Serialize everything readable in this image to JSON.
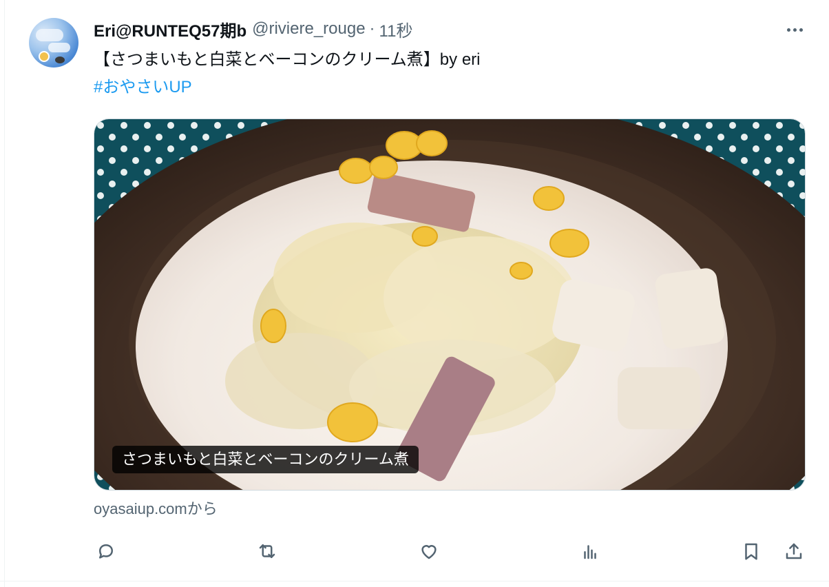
{
  "tweet": {
    "display_name": "Eri@RUNTEQ57期b",
    "handle": "@riviere_rouge",
    "separator": "·",
    "time": "11秒",
    "text": "【さつまいもと白菜とベーコンのクリーム煮】by eri",
    "hashtag": "#おやさいUP"
  },
  "card": {
    "caption": "さつまいもと白菜とベーコンのクリーム煮",
    "source": "oyasaiup.comから"
  },
  "actions": {
    "reply_icon": "reply-icon",
    "retweet_icon": "retweet-icon",
    "like_icon": "heart-icon",
    "views_icon": "analytics-icon",
    "bookmark_icon": "bookmark-icon",
    "share_icon": "share-icon"
  },
  "colors": {
    "accent": "#1d9bf0",
    "secondary_text": "#536471",
    "border": "#cfd9de"
  }
}
